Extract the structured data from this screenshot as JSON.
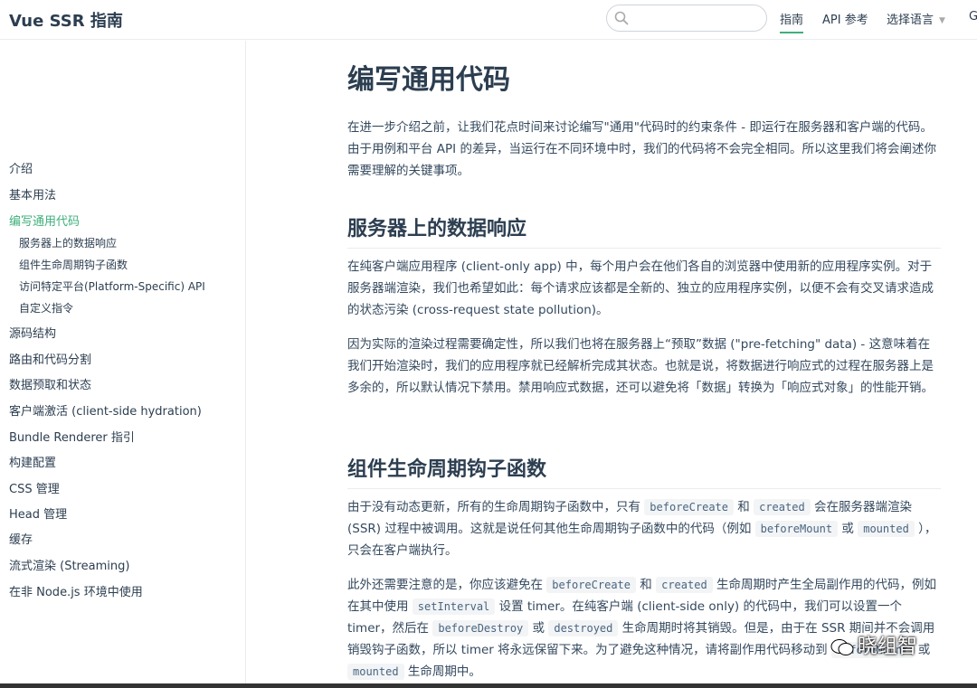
{
  "header": {
    "logo": "Vue SSR 指南",
    "search_placeholder": "",
    "nav": {
      "guide": "指南",
      "api": "API 参考",
      "lang": "选择语言",
      "cut": "G"
    }
  },
  "sidebar": {
    "items": {
      "intro": "介绍",
      "basic": "基本用法",
      "universal": "编写通用代码",
      "sub1": "服务器上的数据响应",
      "sub2": "组件生命周期钩子函数",
      "sub3": "访问特定平台(Platform-Specific) API",
      "sub4": "自定义指令",
      "structure": "源码结构",
      "routing": "路由和代码分割",
      "data": "数据预取和状态",
      "hydration": "客户端激活 (client-side hydration)",
      "bundle": "Bundle Renderer 指引",
      "build": "构建配置",
      "css": "CSS 管理",
      "head": "Head 管理",
      "caching": "缓存",
      "streaming": "流式渲染 (Streaming)",
      "nonnode": "在非 Node.js 环境中使用"
    }
  },
  "content": {
    "title": "编写通用代码",
    "intro": "在进一步介绍之前，让我们花点时间来讨论编写\"通用\"代码时的约束条件 - 即运行在服务器和客户端的代码。由于用例和平台 API 的差异，当运行在不同环境中时，我们的代码将不会完全相同。所以这里我们将会阐述你需要理解的关键事项。",
    "h2_data": "服务器上的数据响应",
    "p_data1": "在纯客户端应用程序 (client-only app) 中，每个用户会在他们各自的浏览器中使用新的应用程序实例。对于服务器端渲染，我们也希望如此：每个请求应该都是全新的、独立的应用程序实例，以便不会有交叉请求造成的状态污染 (cross-request state pollution)。",
    "p_data2": "因为实际的渲染过程需要确定性，所以我们也将在服务器上“预取”数据 (\"pre-fetching\" data) - 这意味着在我们开始渲染时，我们的应用程序就已经解析完成其状态。也就是说，将数据进行响应式的过程在服务器上是多余的，所以默认情况下禁用。禁用响应式数据，还可以避免将「数据」转换为「响应式对象」的性能开销。",
    "h2_hooks": "组件生命周期钩子函数",
    "p_hooks1": {
      "t1": "由于没有动态更新，所有的生命周期钩子函数中，只有 ",
      "c1": "beforeCreate",
      "t2": " 和 ",
      "c2": "created",
      "t3": " 会在服务器端渲染 (SSR) 过程中被调用。这就是说任何其他生命周期钩子函数中的代码（例如 ",
      "c3": "beforeMount",
      "t4": " 或 ",
      "c4": "mounted",
      "t5": " ），只会在客户端执行。"
    },
    "p_hooks2": {
      "t1": "此外还需要注意的是，你应该避免在 ",
      "c1": "beforeCreate",
      "t2": " 和 ",
      "c2": "created",
      "t3": " 生命周期时产生全局副作用的代码，例如在其中使用 ",
      "c3": "setInterval",
      "t4": " 设置 timer。在纯客户端 (client-side only) 的代码中，我们可以设置一个 timer，然后在 ",
      "c4": "beforeDestroy",
      "t5": " 或 ",
      "c5": "destroyed",
      "t6": " 生命周期时将其销毁。但是，由于在 SSR 期间并不会调用销毁钩子函数，所以 timer 将永远保留下来。为了避免这种情况，请将副作用代码移动到 ",
      "c6": "beforeMount",
      "t7": " 或 ",
      "c7": "mounted",
      "t8": " 生命周期中。"
    }
  },
  "watermark": "晓组智",
  "colors": {
    "accent": "#3eaf7c",
    "text": "#34495e",
    "heading": "#2c3e50"
  }
}
